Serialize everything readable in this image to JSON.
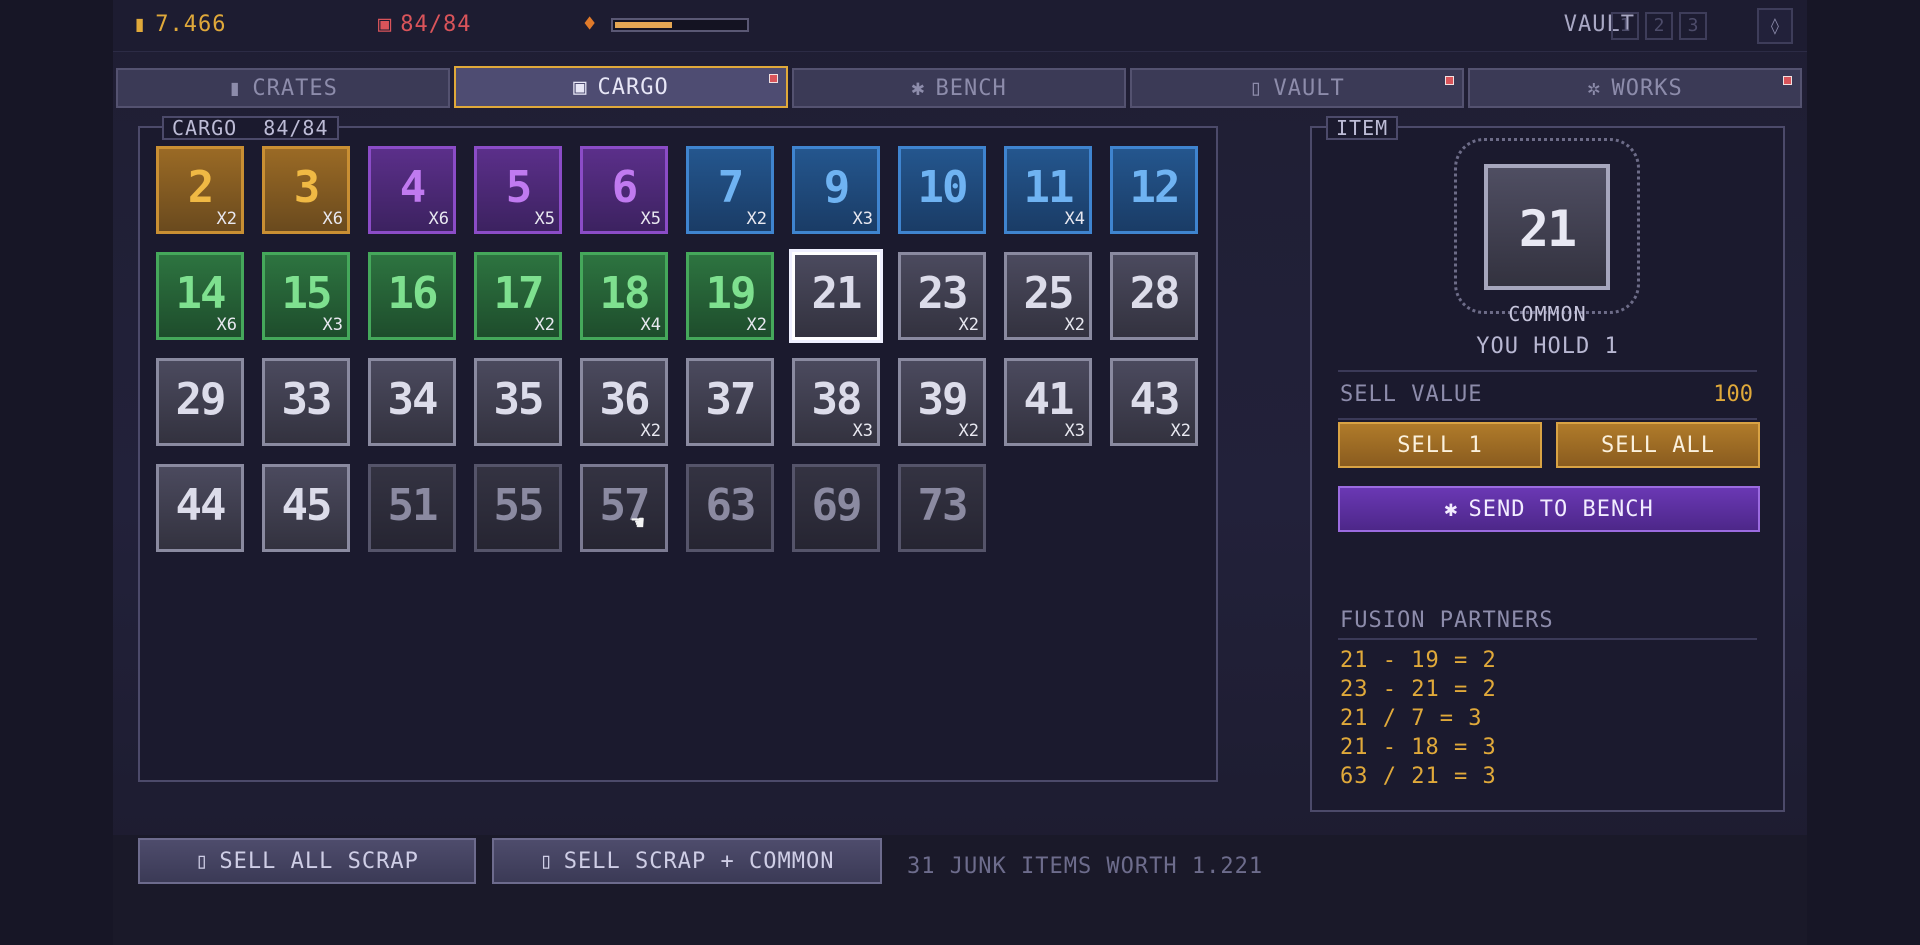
{
  "topbar": {
    "coins": "7.466",
    "cargo": "84/84",
    "heat_fraction": 0.42,
    "vault_label": "VAULT",
    "vault_slots": [
      "1",
      "2",
      "3"
    ],
    "icons": {
      "coins": "coin-stack-icon",
      "cargo": "crate-icon",
      "heat": "flame-icon",
      "settings": "diamond-icon"
    }
  },
  "tabs": [
    {
      "label": "CRATES",
      "icon": "crate-icon",
      "active": false,
      "notify": false
    },
    {
      "label": "CARGO",
      "icon": "crate-icon",
      "active": true,
      "notify": true
    },
    {
      "label": "BENCH",
      "icon": "wrench-icon",
      "active": false,
      "notify": false
    },
    {
      "label": "VAULT",
      "icon": "lock-icon",
      "active": false,
      "notify": true
    },
    {
      "label": "WORKS",
      "icon": "gear-icon",
      "active": false,
      "notify": true
    }
  ],
  "cargo": {
    "title": "CARGO  84/84",
    "items": [
      {
        "n": "2",
        "c": "X2",
        "tier": "gold"
      },
      {
        "n": "3",
        "c": "X6",
        "tier": "gold"
      },
      {
        "n": "4",
        "c": "X6",
        "tier": "purple"
      },
      {
        "n": "5",
        "c": "X5",
        "tier": "purple"
      },
      {
        "n": "6",
        "c": "X5",
        "tier": "purple"
      },
      {
        "n": "7",
        "c": "X2",
        "tier": "blue"
      },
      {
        "n": "9",
        "c": "X3",
        "tier": "blue"
      },
      {
        "n": "10",
        "c": "",
        "tier": "blue"
      },
      {
        "n": "11",
        "c": "X4",
        "tier": "blue"
      },
      {
        "n": "12",
        "c": "",
        "tier": "blue"
      },
      {
        "n": "14",
        "c": "X6",
        "tier": "green"
      },
      {
        "n": "15",
        "c": "X3",
        "tier": "green"
      },
      {
        "n": "16",
        "c": "",
        "tier": "green"
      },
      {
        "n": "17",
        "c": "X2",
        "tier": "green"
      },
      {
        "n": "18",
        "c": "X4",
        "tier": "green"
      },
      {
        "n": "19",
        "c": "X2",
        "tier": "green"
      },
      {
        "n": "21",
        "c": "",
        "tier": "gray",
        "selected": true
      },
      {
        "n": "23",
        "c": "X2",
        "tier": "gray"
      },
      {
        "n": "25",
        "c": "X2",
        "tier": "gray"
      },
      {
        "n": "28",
        "c": "",
        "tier": "gray"
      },
      {
        "n": "29",
        "c": "",
        "tier": "gray"
      },
      {
        "n": "33",
        "c": "",
        "tier": "gray"
      },
      {
        "n": "34",
        "c": "",
        "tier": "gray"
      },
      {
        "n": "35",
        "c": "",
        "tier": "gray"
      },
      {
        "n": "36",
        "c": "X2",
        "tier": "gray"
      },
      {
        "n": "37",
        "c": "",
        "tier": "gray"
      },
      {
        "n": "38",
        "c": "X3",
        "tier": "gray"
      },
      {
        "n": "39",
        "c": "X2",
        "tier": "gray"
      },
      {
        "n": "41",
        "c": "X3",
        "tier": "gray"
      },
      {
        "n": "43",
        "c": "X2",
        "tier": "gray"
      },
      {
        "n": "44",
        "c": "",
        "tier": "gray"
      },
      {
        "n": "45",
        "c": "",
        "tier": "gray"
      },
      {
        "n": "51",
        "c": "",
        "tier": "dark"
      },
      {
        "n": "55",
        "c": "",
        "tier": "dark"
      },
      {
        "n": "57",
        "c": "",
        "tier": "dark",
        "hovered": true
      },
      {
        "n": "63",
        "c": "",
        "tier": "dark"
      },
      {
        "n": "69",
        "c": "",
        "tier": "dark"
      },
      {
        "n": "73",
        "c": "",
        "tier": "dark"
      }
    ]
  },
  "item": {
    "title": "ITEM",
    "number": "21",
    "rarity": "COMMON",
    "hold": "YOU HOLD 1",
    "sell_label": "SELL VALUE",
    "sell_value": "100",
    "sell_one": "SELL 1",
    "sell_all": "SELL ALL",
    "send_bench": "SEND TO BENCH",
    "fusion_title": "FUSION PARTNERS",
    "fusion": [
      "21 - 19 = 2",
      "23 - 21 = 2",
      "21 / 7 = 3",
      "21 - 18 = 3",
      "63 / 21 = 3"
    ]
  },
  "bottom": {
    "sell_scrap": "SELL ALL SCRAP",
    "sell_scrap_common": "SELL SCRAP + COMMON",
    "junk_text": "31 JUNK ITEMS WORTH 1.221"
  },
  "colors": {
    "gold": "#e0a93a",
    "danger": "#d9545a",
    "purple": "#6a38b4"
  }
}
